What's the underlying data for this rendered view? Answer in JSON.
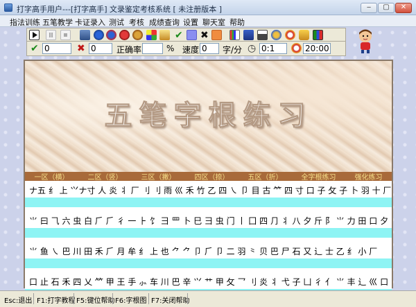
{
  "window": {
    "title": "打字高手用户---[打字高手]      文录鉴定考核系统 [ 未注册版本 ]",
    "min_glyph": "‒",
    "max_glyph": "▢",
    "close_glyph": "✕"
  },
  "menu": [
    "指法训练",
    "五笔教学",
    "卡证录入",
    "测试",
    "考核",
    "成绩查询",
    "设置",
    "聊天室",
    "帮助"
  ],
  "stats": {
    "correct_count": "0",
    "wrong_count": "0",
    "accuracy_label": "正确率",
    "accuracy_value": "",
    "percent_sign": "%",
    "speed_label": "速度",
    "speed_value": "0",
    "speed_unit": "字/分",
    "ratio_value": "0:1",
    "time_value": "20:00"
  },
  "practice": {
    "banner_title": "五笔字根练习",
    "zones": [
      "一区（横）",
      "二区（竖）",
      "三区（撇）",
      "四区（捺）",
      "五区（折）",
      "全字根练习",
      "强化练习"
    ],
    "rows": [
      "ナ五 纟 上 ⺍ナ寸 人 炎 丬 厂 刂 刂 雨 巛 禾 竹 乙 四 ㇏ 卩 目 古 ⺮ 四 寸 口 子 攵 子 卜 羽 十 厂",
      "⺌ 曰 ⺄ 六 虫 白 ⺁ ⺁ 彳 一 ⺊ 饣 ⺕ 罒 卜 巳 ⺕ 虫 门 丨 囗 四 ⺆ 丬 八 夕 斤 ⻖ ⺌ 力 田 口 夕 阝",
      "⺌ 鱼 ㇏ 巴 川 田 禾 ⺁ 月 牟 纟 上 也 ⺈ ⺈ 卩 ⺁ 卩 二 羽 ⺀ 贝 巴 尸 石 又 辶 士 乙 纟 小 厂",
      "口 止 石 禾 四 乂 ⺮ 甲 王 手 ⺗ 车 川 巴 辛 ⺍ 艹 甲 攵 ⺂ 刂 炎 丬 弋 子 凵 彳 亻 ⺌ 丰 ⻌ 巛 口"
    ]
  },
  "status": [
    "Esc:退出",
    "F1:打字教程",
    "F5:键位帮助",
    "F6:字根图",
    "F7:关闭帮助"
  ],
  "colors": {
    "input_row": "#8ef4f4",
    "zone_bar": "#a86a3a",
    "zone_text": "#f6e08a"
  }
}
